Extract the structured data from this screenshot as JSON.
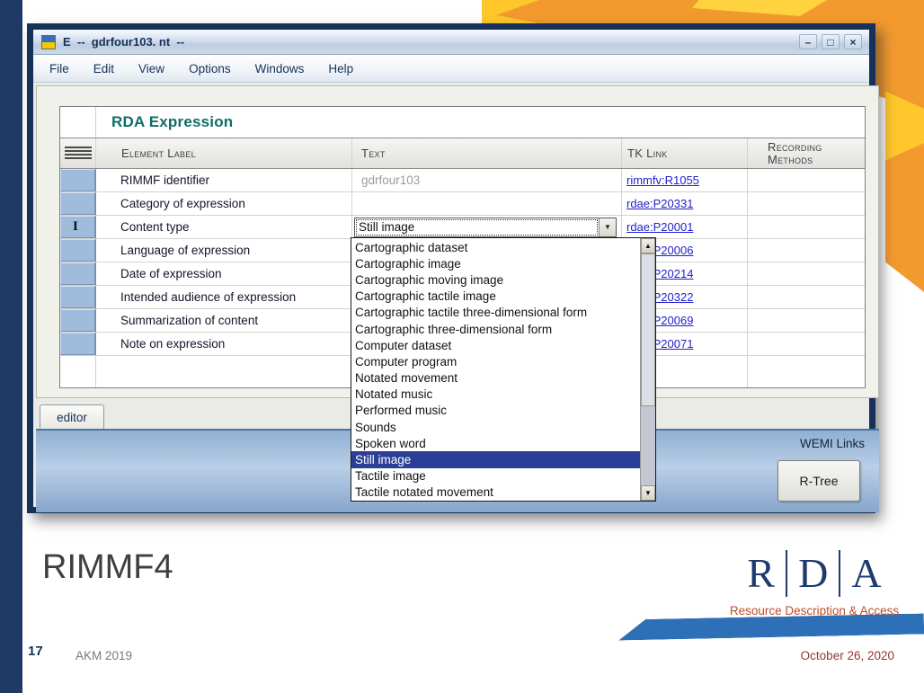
{
  "colors": {
    "accent_orange": "#F29A2E",
    "accent_yellow": "#FFC72C",
    "ribbon_blue": "#2E70B8",
    "navy_bar": "#1E3A64",
    "link_blue": "#2222CC",
    "table_title_teal": "#0E6E66",
    "dropdown_selection_blue": "#2B3F96",
    "row_selector_blue": "#9FBCDC"
  },
  "icons": {
    "scroll_up": "▲",
    "scroll_down": "▼",
    "dropdown_arrow": "▼",
    "text_cursor": "I",
    "minimize": "–",
    "maximize": "□",
    "close": "×",
    "grip": "hamburger-lines",
    "app_icon": "blue-yellow-flag"
  },
  "slide": {
    "page_number": "17",
    "title": "RIMMF4",
    "footer_left": "AKM 2019",
    "footer_right": "October 26, 2020",
    "logo_letters": [
      "R",
      "D",
      "A"
    ],
    "logo_caption": "Resource Description & Access"
  },
  "window": {
    "title": "E  --  gdrfour103. nt  --",
    "menus": [
      "File",
      "Edit",
      "View",
      "Options",
      "Windows",
      "Help"
    ],
    "table": {
      "title": "RDA Expression",
      "columns": [
        "Element Label",
        "Text",
        "TK Link",
        "Recording Methods"
      ],
      "rows": [
        {
          "label": "RIMMF identifier",
          "text": "gdrfour103",
          "link": "rimmfv:R1055"
        },
        {
          "label": "Category of expression",
          "text": "",
          "link": "rdae:P20331"
        },
        {
          "label": "Content type",
          "text": "Still image",
          "link": "rdae:P20001"
        },
        {
          "label": "Language of expression",
          "text": "",
          "link": "rdae:P20006"
        },
        {
          "label": "Date of expression",
          "text": "",
          "link": "rdae:P20214"
        },
        {
          "label": "Intended audience of expression",
          "text": "",
          "link": "rdae:P20322"
        },
        {
          "label": "Summarization of content",
          "text": "",
          "link": "rdae:P20069"
        },
        {
          "label": "Note on expression",
          "text": "",
          "link": "rdae:P20071"
        }
      ]
    },
    "dropdown": {
      "selected": "Still image",
      "items": [
        "Cartographic dataset",
        "Cartographic image",
        "Cartographic moving image",
        "Cartographic tactile image",
        "Cartographic tactile three-dimensional form",
        "Cartographic three-dimensional form",
        "Computer dataset",
        "Computer program",
        "Notated movement",
        "Notated music",
        "Performed music",
        "Sounds",
        "Spoken word",
        "Still image",
        "Tactile image",
        "Tactile notated movement"
      ]
    },
    "editor_tab": "editor",
    "wemi_links": "WEMI Links",
    "rtree_button": "R-Tree"
  }
}
